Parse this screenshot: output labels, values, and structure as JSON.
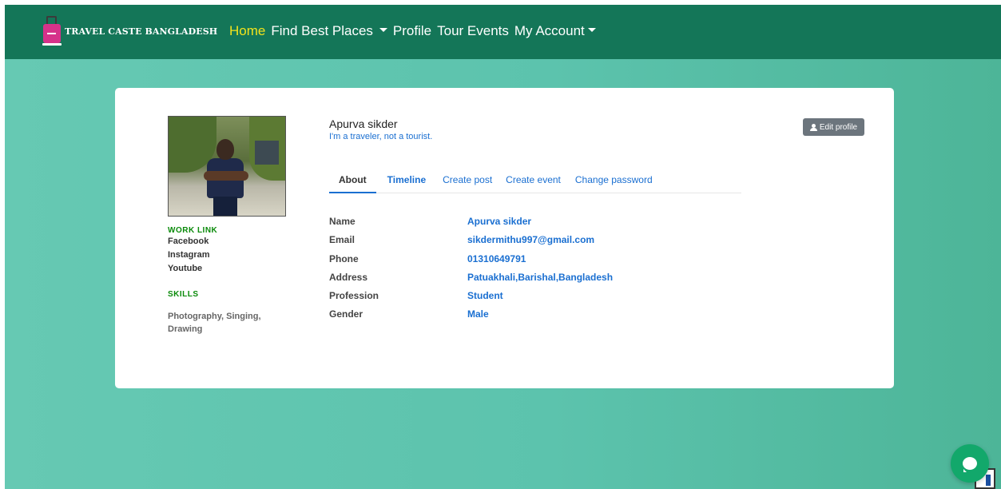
{
  "brand": {
    "name": "TRAVEL CASTE BANGLADESH"
  },
  "nav": {
    "home": "Home",
    "find_best_places": "Find Best Places",
    "profile": "Profile",
    "tour_events": "Tour Events",
    "my_account": "My Account"
  },
  "sidebar": {
    "work_link_heading": "WORK LINK",
    "links": [
      "Facebook",
      "Instagram",
      "Youtube"
    ],
    "skills_heading": "SKILLS",
    "skills": "Photography, Singing, Drawing"
  },
  "profile": {
    "name": "Apurva sikder",
    "tagline": "I'm a traveler, not a tourist.",
    "edit_label": "Edit profile"
  },
  "tabs": [
    "About",
    "Timeline",
    "Create post",
    "Create event",
    "Change password"
  ],
  "about": {
    "rows": [
      {
        "label": "Name",
        "value": "Apurva sikder"
      },
      {
        "label": "Email",
        "value": "sikdermithu997@gmail.com"
      },
      {
        "label": "Phone",
        "value": "01310649791"
      },
      {
        "label": "Address",
        "value": "Patuakhali,Barishal,Bangladesh"
      },
      {
        "label": "Profession",
        "value": "Student"
      },
      {
        "label": "Gender",
        "value": "Male"
      }
    ]
  },
  "colors": {
    "navbar": "#147658",
    "active_nav": "#f2e21c",
    "link_blue": "#1a6fd1",
    "heading_green": "#0a8a0a",
    "chat_green": "#12a86b"
  }
}
